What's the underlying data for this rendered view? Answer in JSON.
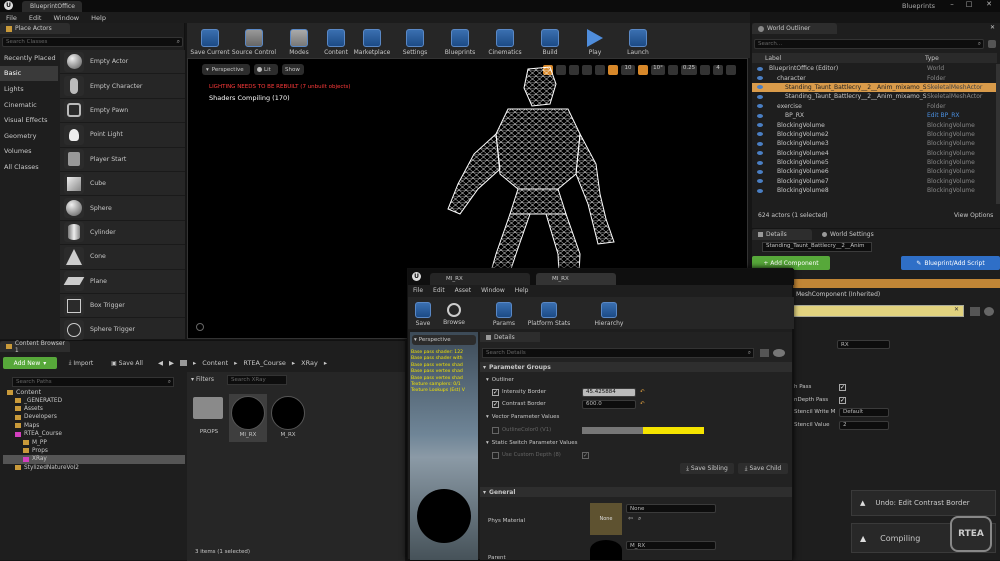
{
  "titlebar": {
    "tab": "BlueprintOffice",
    "right_label": "Blueprints"
  },
  "menu": [
    "File",
    "Edit",
    "Window",
    "Help"
  ],
  "place_actors": {
    "tab": "Place Actors",
    "search_placeholder": "Search Classes",
    "categories": [
      "Recently Placed",
      "Basic",
      "Lights",
      "Cinematic",
      "Visual Effects",
      "Geometry",
      "Volumes",
      "All Classes"
    ],
    "items": [
      "Empty Actor",
      "Empty Character",
      "Empty Pawn",
      "Point Light",
      "Player Start",
      "Cube",
      "Sphere",
      "Cylinder",
      "Cone",
      "Plane",
      "Box Trigger",
      "Sphere Trigger"
    ]
  },
  "toolbar": [
    "Save Current",
    "Source Control",
    "Modes",
    "Content",
    "Marketplace",
    "Settings",
    "Blueprints",
    "Cinematics",
    "Build",
    "Play",
    "Launch"
  ],
  "viewport": {
    "perspective": "Perspective",
    "lit": "Lit",
    "show": "Show",
    "warning": "LIGHTING NEEDS TO BE REBUILT (7 unbuilt objects)",
    "shaders": "Shaders Compiling (170)",
    "snap_values": [
      "10",
      "10°",
      "0.25",
      "4"
    ]
  },
  "outliner": {
    "tab": "World Outliner",
    "search_placeholder": "Search...",
    "col_label": "Label",
    "col_type": "Type",
    "rows": [
      {
        "label": "BlueprintOffice (Editor)",
        "type": "World"
      },
      {
        "label": "character",
        "type": "Folder"
      },
      {
        "label": "Standing_Taunt_Battlecry__2__Anim_mixamo_Skel",
        "type": "SkeletalMeshActor"
      },
      {
        "label": "Standing_Taunt_Battlecry__2__Anim_mixamo_Skel",
        "type": "SkeletalMeshActor"
      },
      {
        "label": "exercise",
        "type": "Folder"
      },
      {
        "label": "BP_RX",
        "type": "Edit BP_RX"
      },
      {
        "label": "BlockingVolume",
        "type": "BlockingVolume"
      },
      {
        "label": "BlockingVolume2",
        "type": "BlockingVolume"
      },
      {
        "label": "BlockingVolume3",
        "type": "BlockingVolume"
      },
      {
        "label": "BlockingVolume4",
        "type": "BlockingVolume"
      },
      {
        "label": "BlockingVolume5",
        "type": "BlockingVolume"
      },
      {
        "label": "BlockingVolume6",
        "type": "BlockingVolume"
      },
      {
        "label": "BlockingVolume7",
        "type": "BlockingVolume"
      },
      {
        "label": "BlockingVolume8",
        "type": "BlockingVolume"
      }
    ],
    "status": "624 actors (1 selected)",
    "view_options": "View Options"
  },
  "details": {
    "tab": "Details",
    "tab2": "World Settings",
    "actor_name": "Standing_Taunt_Battlecry__2__Anim",
    "add_component": "+ Add Component",
    "blueprint_script": "Blueprint/Add Script",
    "inherited": "MeshComponent (Inherited)",
    "rx_value": "RX",
    "rows": [
      {
        "label": "h Pass"
      },
      {
        "label": "nDepth Pass"
      },
      {
        "label": "Stencil Write M",
        "value": "Default"
      },
      {
        "label": "Stencil Value",
        "value": "2"
      }
    ]
  },
  "content_browser": {
    "tab": "Content Browser 1",
    "add_new": "Add New",
    "import": "Import",
    "save_all": "Save All",
    "search_paths": "Search Paths",
    "breadcrumb": [
      "Content",
      "RTEA_Course",
      "XRay"
    ],
    "filters": "Filters",
    "search_placeholder": "Search XRay",
    "tree": [
      "Content",
      "_GENERATED",
      "Assets",
      "Developers",
      "Maps",
      "RTEA_Course",
      "M_PP",
      "Props",
      "XRay",
      "StylizedNatureVol2"
    ],
    "assets": [
      "PROPS",
      "MI_RX",
      "M_RX"
    ],
    "status": "3 items (1 selected)"
  },
  "material_editor": {
    "tabs": [
      "MI_RX",
      "MI_RX"
    ],
    "menu": [
      "File",
      "Edit",
      "Asset",
      "Window",
      "Help"
    ],
    "toolbar": [
      "Save",
      "Browse",
      "Params",
      "Platform Stats",
      "Hierarchy"
    ],
    "perspective": "Perspective",
    "details_tab": "Details",
    "search_placeholder": "Search Details",
    "parameter_groups": "Parameter Groups",
    "outliner_group": "Outliner",
    "intensity_label": "Intensity Border",
    "intensity_value": "45.425884",
    "contrast_label": "Contrast Border",
    "contrast_value": "600.0",
    "vector_group": "Vector Parameter Values",
    "outline_color": "OutlineColor0 (V1)",
    "static_switch": "Static Switch Parameter Values",
    "use_custom_depth": "Use Custom Depth (8)",
    "save_sibling": "Save Sibling",
    "save_child": "Save Child",
    "general": "General",
    "phys_material": "Phys Material",
    "phys_value": "None",
    "phys_thumb": "None",
    "parent": "Parent",
    "parent_value": "M_RX",
    "stats_lines": [
      "Base pass shader: 122",
      "Base pass shader with",
      "Base pass vertex shad",
      "Base pass vertex shad",
      "Base pass vertex shad",
      "Texture samplers: 0/1",
      "Texture Lookups (Est) V"
    ]
  },
  "notifications": {
    "undo": "Undo: Edit Contrast Border",
    "compiling": "Compiling"
  },
  "watermark": "RTEA",
  "colors": {
    "accent": "#3b7cd4",
    "warning": "#ff3a3a",
    "yellow": "#f5e400",
    "green": "#57a83a",
    "orange": "#d6892d",
    "select": "#c18636"
  }
}
